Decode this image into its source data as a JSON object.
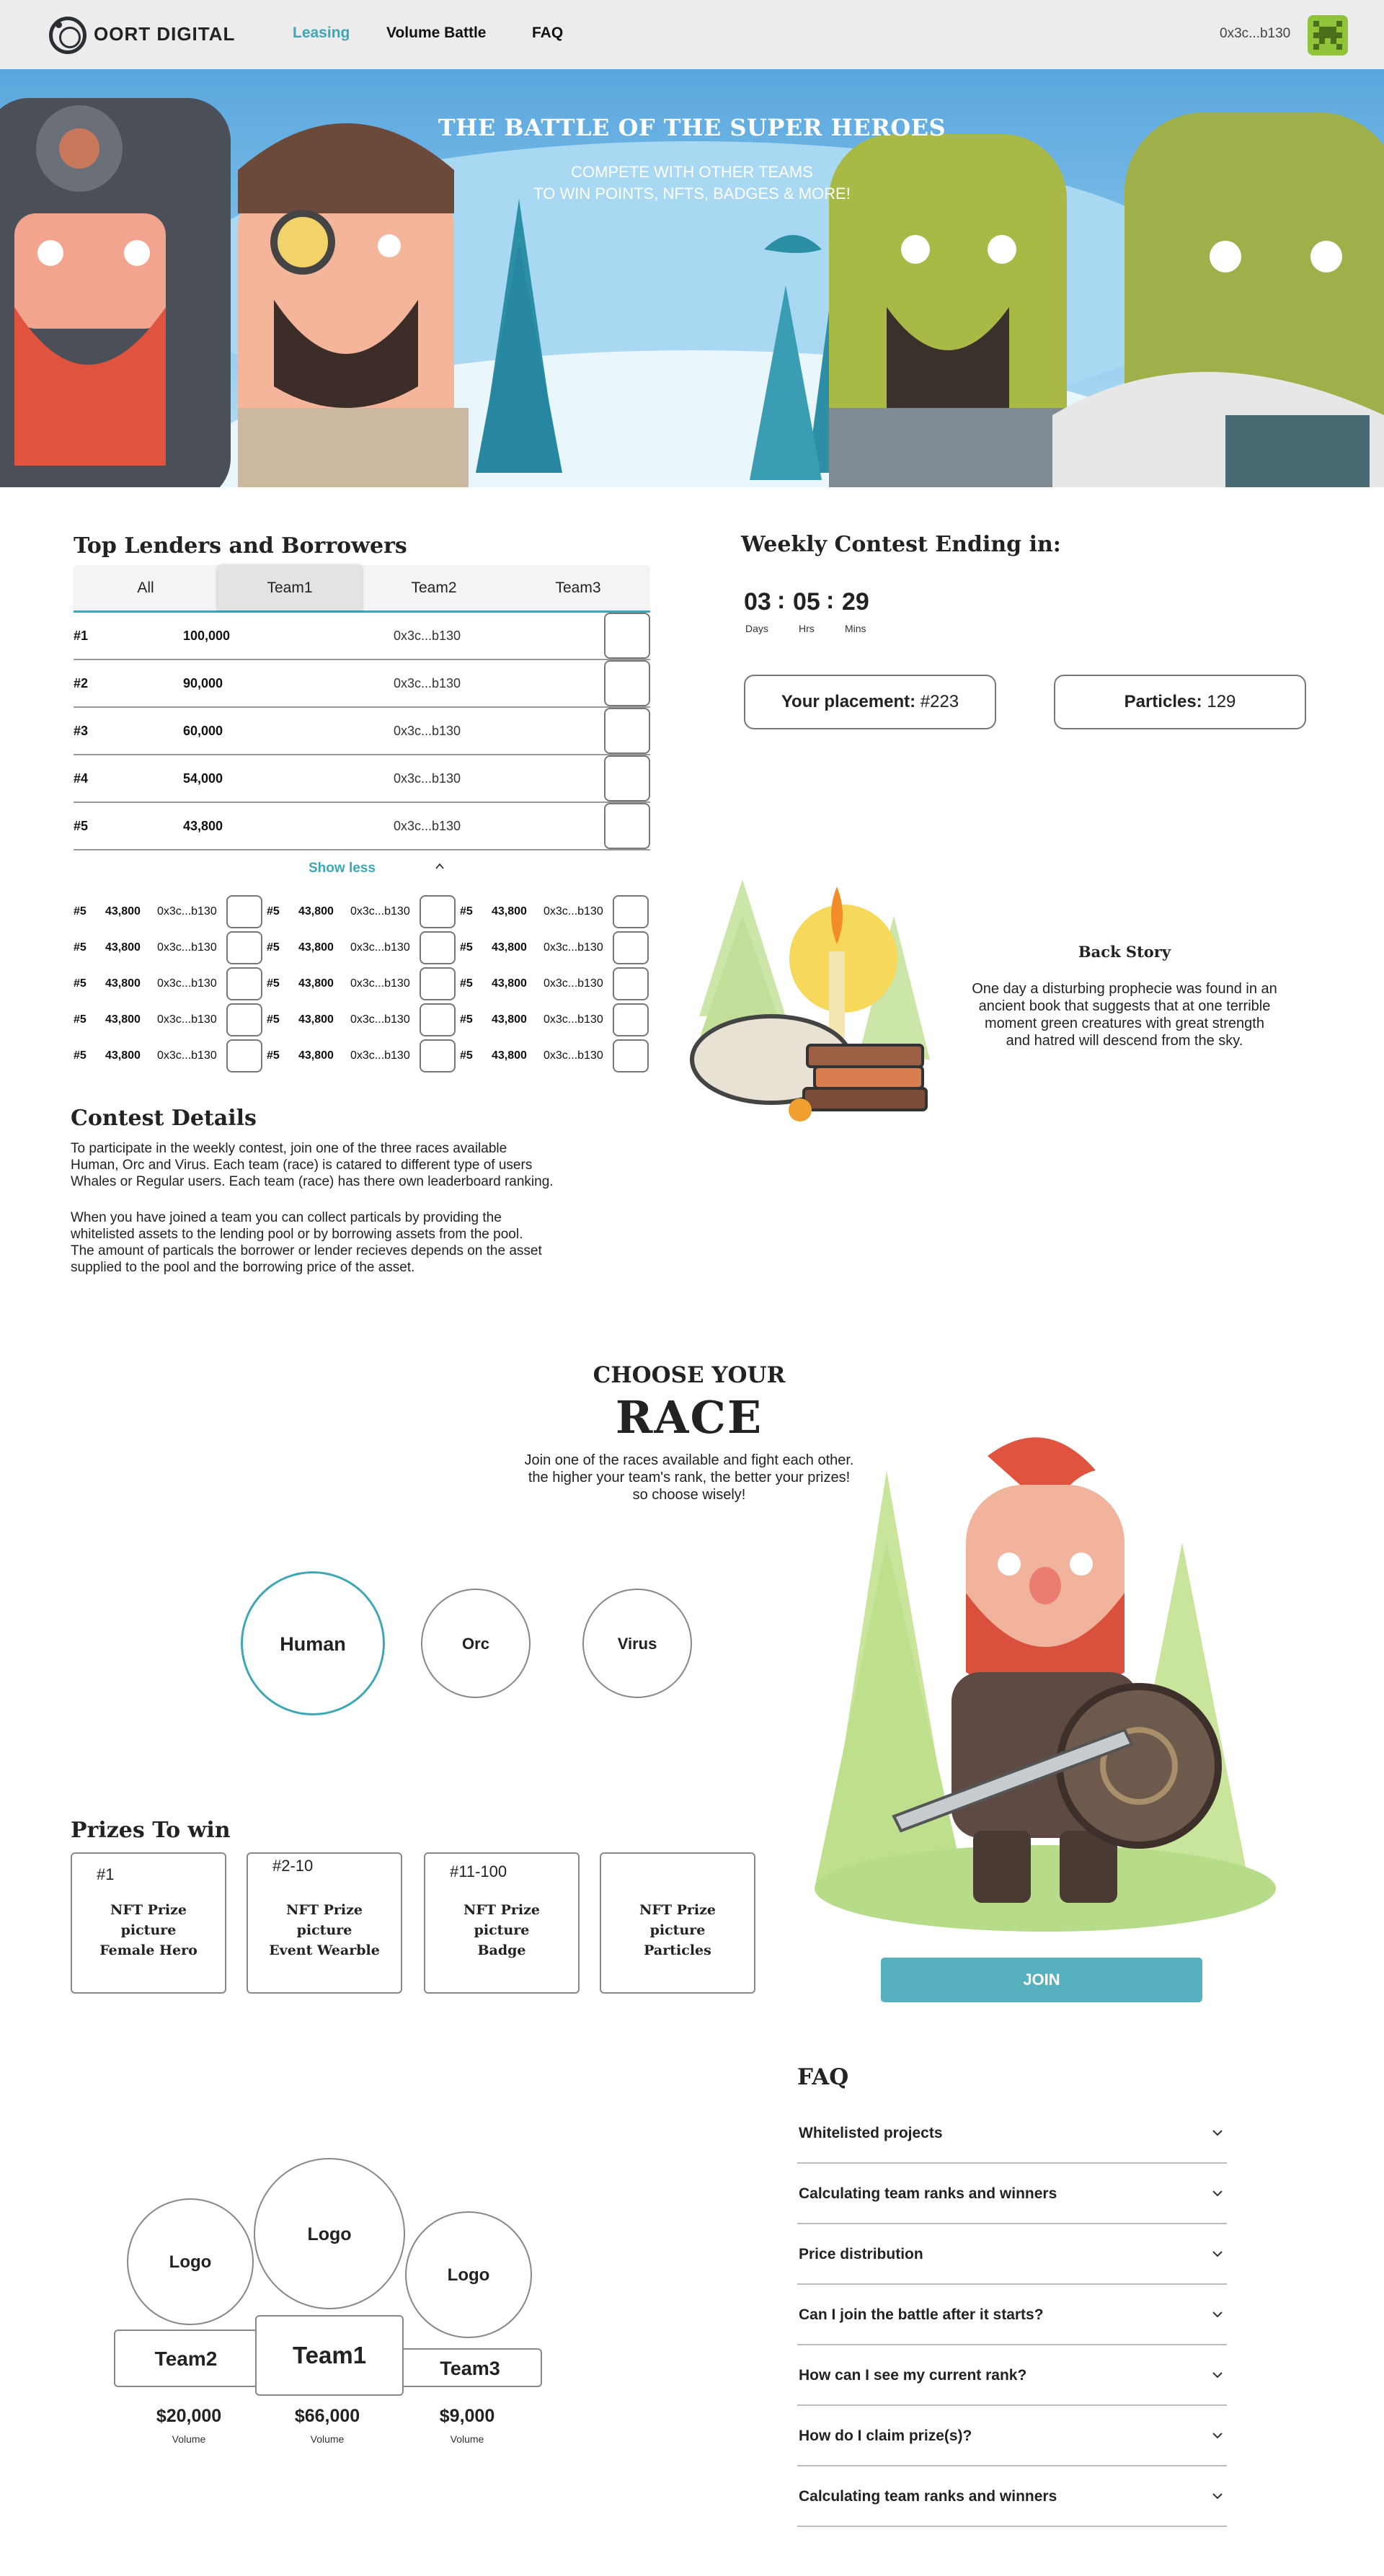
{
  "nav": {
    "brand": "OORT DIGITAL",
    "links": [
      "Leasing",
      "Volume Battle",
      "FAQ"
    ],
    "active": "Leasing",
    "wallet": "0x3c...b130",
    "accent": "#3ea7b6"
  },
  "hero": {
    "title": "THE BATTLE OF THE SUPER HEROES",
    "subtitle_line1": "COMPETE WITH OTHER TEAMS",
    "subtitle_line2": "TO WIN POINTS, NFTS, BADGES & MORE!"
  },
  "leaderboard": {
    "title": "Top Lenders and Borrowers",
    "tabs": [
      "All",
      "Team1",
      "Team2",
      "Team3"
    ],
    "active_tab": "Team1",
    "rows": [
      {
        "rank": "#1",
        "value": "100,000",
        "address": "0x3c...b130"
      },
      {
        "rank": "#2",
        "value": "90,000",
        "address": "0x3c...b130"
      },
      {
        "rank": "#3",
        "value": "60,000",
        "address": "0x3c...b130"
      },
      {
        "rank": "#4",
        "value": "54,000",
        "address": "0x3c...b130"
      },
      {
        "rank": "#5",
        "value": "43,800",
        "address": "0x3c...b130"
      }
    ],
    "show_less": "Show less",
    "mini_row": {
      "rank": "#5",
      "value": "43,800",
      "address": "0x3c...b130"
    }
  },
  "contest": {
    "title": "Contest Details",
    "p1": [
      "To participate in the weekly contest, join one of the three races available",
      "Human, Orc and Virus. Each team (race) is catared to different type of users",
      "Whales or Regular users. Each team (race) has there own leaderboard ranking."
    ],
    "p2": [
      "When you have joined a team you can collect particals by providing the",
      "whitelisted assets to the lending pool or by borrowing assets from the pool.",
      "The amount of particals the borrower or lender recieves depends on the asset",
      "supplied to the pool and the borrowing price of the asset."
    ]
  },
  "weekly": {
    "title": "Weekly Contest Ending in:",
    "days": "03",
    "hrs": "05",
    "mins": "29",
    "days_label": "Days",
    "hrs_label": "Hrs",
    "mins_label": "Mins",
    "placement_label": "Your placement:",
    "placement_value": "#223",
    "particles_label": "Particles:",
    "particles_value": "129"
  },
  "backstory": {
    "title": "Back Story",
    "text": [
      "One day a disturbing prophecie was found in an",
      "ancient book that suggests that at one terrible",
      "moment green creatures with great strength",
      "and hatred will descend from the sky."
    ]
  },
  "race": {
    "small": "CHOOSE YOUR",
    "big": "RACE",
    "desc": [
      "Join one of the races available and fight each other.",
      "the higher your team's rank, the better your prizes!",
      "so choose wisely!"
    ],
    "options": [
      "Human",
      "Orc",
      "Virus"
    ],
    "selected": "Human",
    "join": "JOIN"
  },
  "prizes": {
    "title": "Prizes To win",
    "items": [
      {
        "rank": "#1",
        "l1": "NFT Prize",
        "l2": "picture",
        "l3": "Female Hero"
      },
      {
        "rank": "#2-10",
        "l1": "NFT Prize",
        "l2": "picture",
        "l3": "Event Wearble"
      },
      {
        "rank": "#11-100",
        "l1": "NFT Prize",
        "l2": "picture",
        "l3": "Badge"
      },
      {
        "rank": "",
        "l1": "NFT Prize",
        "l2": "picture",
        "l3": "Particles"
      }
    ]
  },
  "podium": {
    "logo": "Logo",
    "team1": "Team1",
    "team2": "Team2",
    "team3": "Team3",
    "team1_volume": "$66,000",
    "team2_volume": "$20,000",
    "team3_volume": "$9,000",
    "volume_label": "Volume"
  },
  "faq": {
    "title": "FAQ",
    "items": [
      "Whitelisted projects",
      "Calculating team ranks and winners",
      "Price distribution",
      "Can I join the battle after it starts?",
      "How can I see my current rank?",
      "How do I claim prize(s)?",
      "Calculating team ranks and winners"
    ]
  }
}
